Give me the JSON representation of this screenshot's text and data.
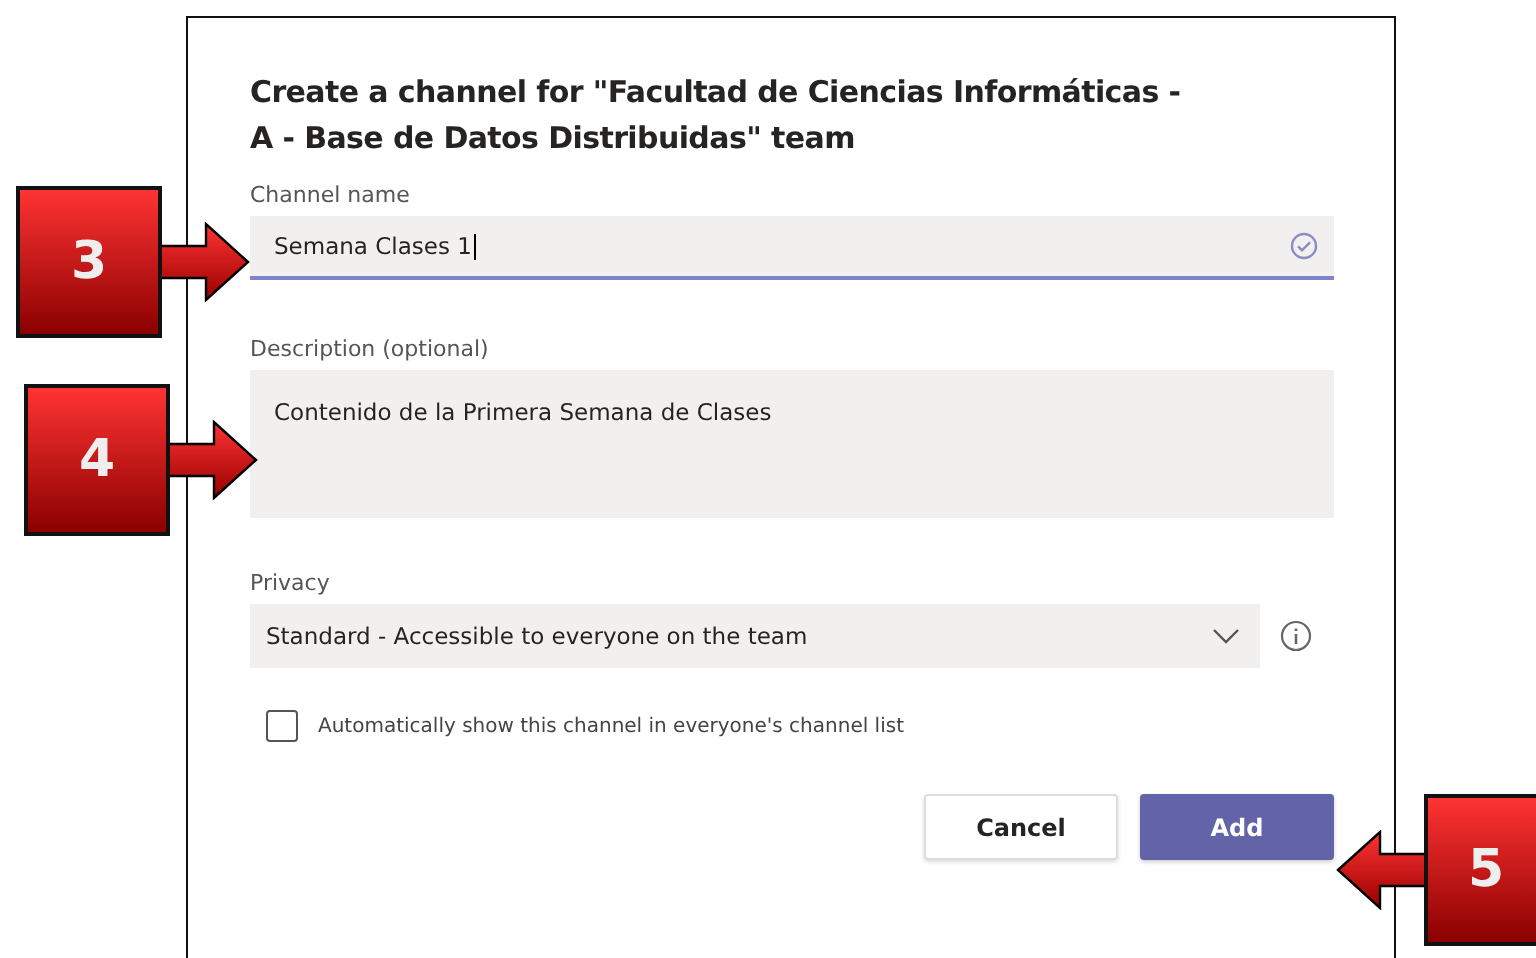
{
  "dialog": {
    "title": "Create a channel for \"Facultad de Ciencias Informáticas - A - Base de Datos Distribuidas\" team",
    "channel_name": {
      "label": "Channel name",
      "value": "Semana Clases 1",
      "focused": true
    },
    "description": {
      "label": "Description (optional)",
      "value": "Contenido de la Primera Semana de Clases"
    },
    "privacy": {
      "label": "Privacy",
      "value": "Standard - Accessible to everyone on the team"
    },
    "auto_show": {
      "label": "Automatically show this channel in everyone's channel list",
      "checked": false
    },
    "buttons": [
      {
        "label": "Cancel",
        "kind": "secondary"
      },
      {
        "label": "Add",
        "kind": "primary"
      }
    ]
  },
  "callouts": [
    {
      "number": "3",
      "kind": "right"
    },
    {
      "number": "4",
      "kind": "right"
    },
    {
      "number": "5",
      "kind": "left"
    }
  ]
}
